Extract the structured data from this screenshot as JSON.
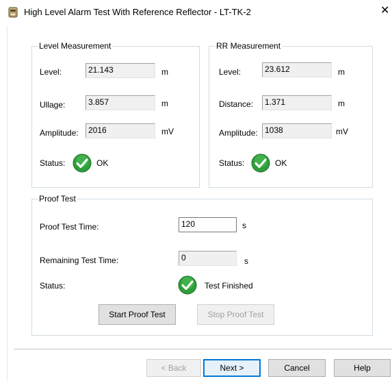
{
  "window": {
    "title": "High Level Alarm Test With Reference Reflector - LT-TK-2",
    "close_glyph": "✕"
  },
  "level_measurement": {
    "legend": "Level Measurement",
    "level_label": "Level:",
    "level_value": "21.143",
    "level_unit": "m",
    "ullage_label": "Ullage:",
    "ullage_value": "3.857",
    "ullage_unit": "m",
    "amplitude_label": "Amplitude:",
    "amplitude_value": "2016",
    "amplitude_unit": "mV",
    "status_label": "Status:",
    "status_text": "OK"
  },
  "rr_measurement": {
    "legend": "RR Measurement",
    "level_label": "Level:",
    "level_value": "23.612",
    "level_unit": "m",
    "distance_label": "Distance:",
    "distance_value": "1.371",
    "distance_unit": "m",
    "amplitude_label": "Amplitude:",
    "amplitude_value": "1038",
    "amplitude_unit": "mV",
    "status_label": "Status:",
    "status_text": "OK"
  },
  "proof_test": {
    "legend": "Proof Test",
    "time_label": "Proof Test Time:",
    "time_value": "120",
    "time_unit": "s",
    "remaining_label": "Remaining Test Time:",
    "remaining_value": "0",
    "remaining_unit": "s",
    "status_label": "Status:",
    "status_text": "Test Finished",
    "start_button": "Start Proof Test",
    "stop_button": "Stop Proof Test"
  },
  "wizard_buttons": {
    "back": "< Back",
    "next": "Next >",
    "cancel": "Cancel",
    "help": "Help"
  },
  "colors": {
    "ok_green": "#2e9e3a",
    "group_border": "#cfdbe4",
    "default_button_border": "#0078d7"
  }
}
